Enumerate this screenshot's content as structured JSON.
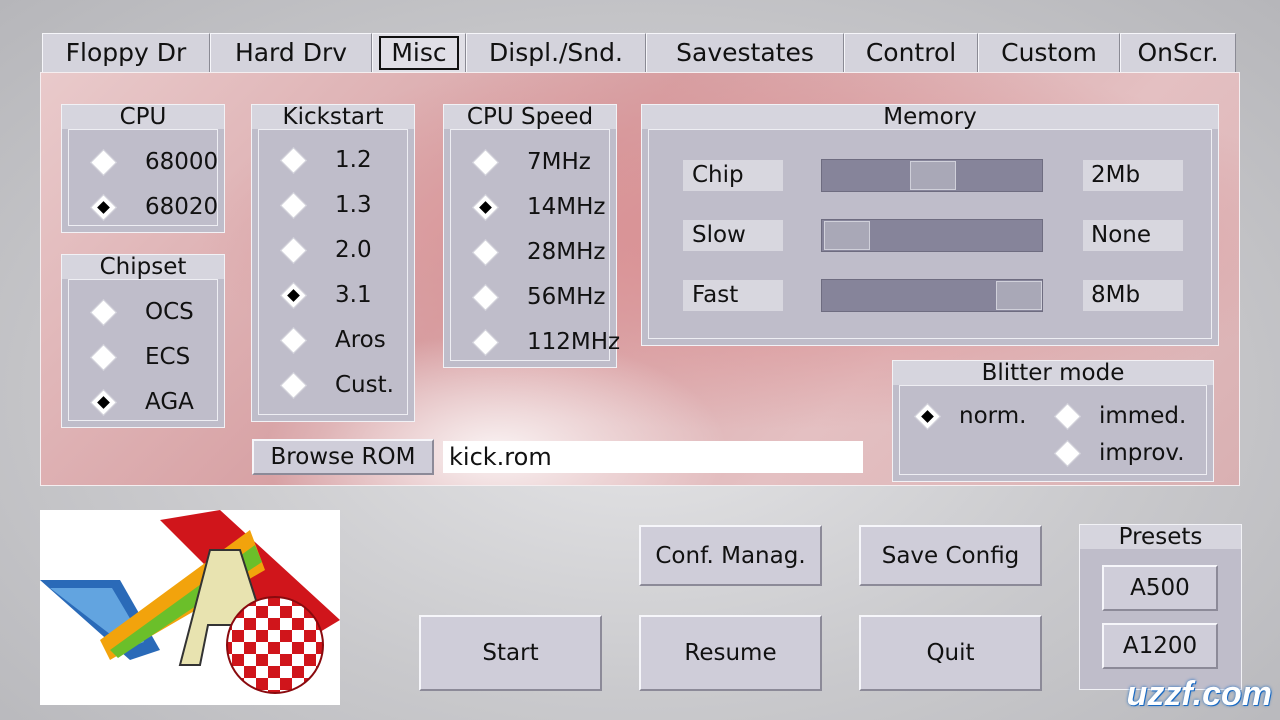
{
  "tabs": [
    {
      "label": "Floppy Dr"
    },
    {
      "label": "Hard Drv"
    },
    {
      "label": "Misc"
    },
    {
      "label": "Displ./Snd."
    },
    {
      "label": "Savestates"
    },
    {
      "label": "Control"
    },
    {
      "label": "Custom"
    },
    {
      "label": "OnScr."
    }
  ],
  "active_tab": "Misc",
  "cpu": {
    "title": "CPU",
    "options": [
      {
        "label": "68000",
        "selected": false
      },
      {
        "label": "68020",
        "selected": true
      }
    ]
  },
  "chipset": {
    "title": "Chipset",
    "options": [
      {
        "label": "OCS",
        "selected": false
      },
      {
        "label": "ECS",
        "selected": false
      },
      {
        "label": "AGA",
        "selected": true
      }
    ]
  },
  "kickstart": {
    "title": "Kickstart",
    "options": [
      {
        "label": "1.2",
        "selected": false
      },
      {
        "label": "1.3",
        "selected": false
      },
      {
        "label": "2.0",
        "selected": false
      },
      {
        "label": "3.1",
        "selected": true
      },
      {
        "label": "Aros",
        "selected": false
      },
      {
        "label": "Cust.",
        "selected": false
      }
    ]
  },
  "cpu_speed": {
    "title": "CPU Speed",
    "options": [
      {
        "label": "7MHz",
        "selected": false
      },
      {
        "label": "14MHz",
        "selected": true
      },
      {
        "label": "28MHz",
        "selected": false
      },
      {
        "label": "56MHz",
        "selected": false
      },
      {
        "label": "112MHz",
        "selected": false
      }
    ]
  },
  "memory": {
    "title": "Memory",
    "chip": {
      "label": "Chip",
      "value": "2Mb",
      "level": 0.5
    },
    "slow": {
      "label": "Slow",
      "value": "None",
      "level": 0.0
    },
    "fast": {
      "label": "Fast",
      "value": "8Mb",
      "level": 1.0
    }
  },
  "blitter": {
    "title": "Blitter mode",
    "options": [
      {
        "label": "norm.",
        "selected": true
      },
      {
        "label": "immed.",
        "selected": false
      },
      {
        "label": "improv.",
        "selected": false
      }
    ]
  },
  "rom": {
    "browse_label": "Browse ROM",
    "path": "kick.rom"
  },
  "buttons": {
    "conf_manag": "Conf. Manag.",
    "save_config": "Save Config",
    "start": "Start",
    "resume": "Resume",
    "quit": "Quit"
  },
  "presets": {
    "title": "Presets",
    "a500": "A500",
    "a1200": "A1200"
  },
  "watermark": "uzzf.com"
}
